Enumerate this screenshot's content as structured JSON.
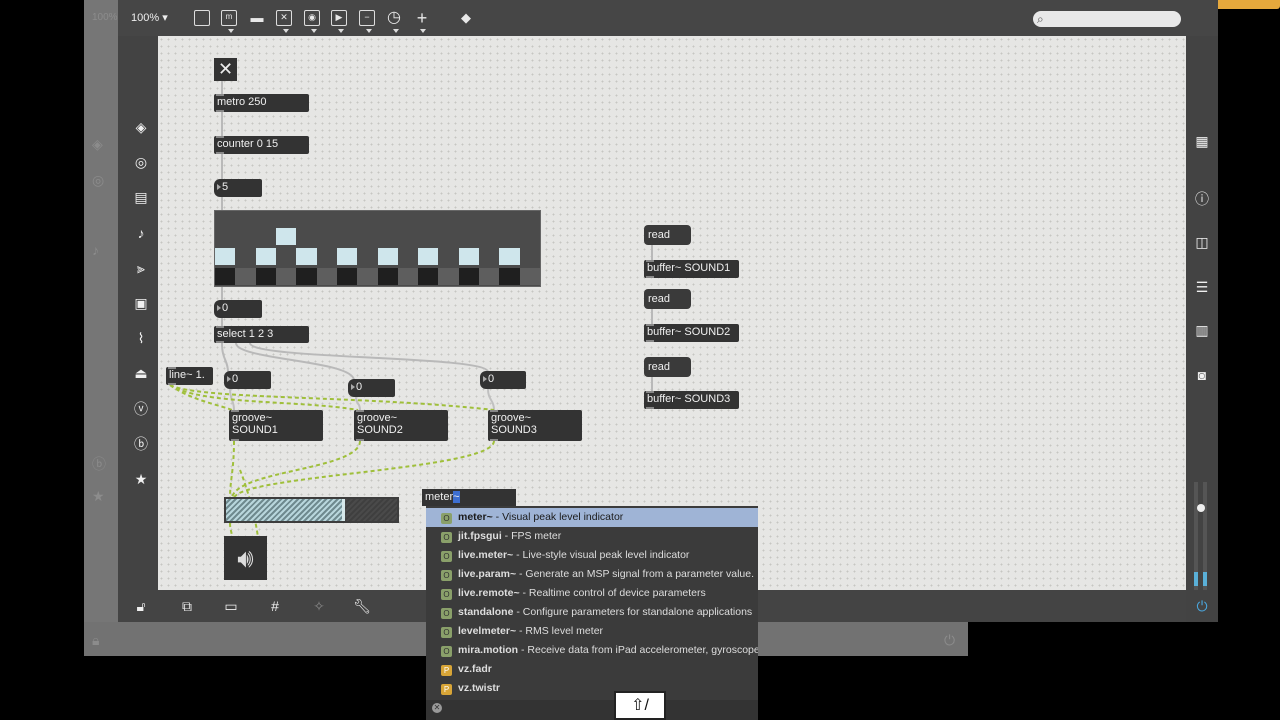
{
  "toolbar": {
    "zoom": "100% ▾",
    "icons": [
      "presentation-icon",
      "message-icon",
      "comment-icon",
      "toggle-icon",
      "button-icon",
      "play-icon",
      "slider-icon",
      "dial-icon",
      "plus-icon",
      "paint-icon"
    ]
  },
  "objects": {
    "metro": "metro 250",
    "counter": "counter 0 15",
    "num_counter": "5",
    "num_step": "0",
    "select": "select 1 2 3",
    "line": "line~ 1.",
    "num1": "0",
    "num2": "0",
    "num3": "0",
    "groove1": "groove~\nSOUND1",
    "groove2": "groove~\nSOUND2",
    "groove3": "groove~\nSOUND3",
    "read1": "read",
    "read2": "read",
    "read3": "read",
    "buffer1": "buffer~ SOUND1",
    "buffer2": "buffer~ SOUND2",
    "buffer3": "buffer~ SOUND3"
  },
  "meter": {
    "level": 0.68
  },
  "matrix": {
    "columns": 16,
    "rows": 3,
    "active_column_pattern": [
      1,
      0,
      1,
      0,
      1,
      0,
      1,
      0,
      1,
      0,
      1,
      0,
      1,
      0,
      1,
      0
    ],
    "highlight_col": 3,
    "colors": {
      "on": "#cfe6ec",
      "off": "#4b4b4b",
      "dark": "#1f1f1f",
      "mid": "#5e5e5e"
    }
  },
  "typing": {
    "prefix": "meter",
    "selected": "~"
  },
  "autocomplete": [
    {
      "type": "O",
      "name": "meter~",
      "desc": " - Visual peak level indicator",
      "selected": true
    },
    {
      "type": "O",
      "name": "jit.fpsgui",
      "desc": " - FPS meter"
    },
    {
      "type": "O",
      "name": "live.meter~",
      "desc": " - Live-style visual peak level indicator"
    },
    {
      "type": "O",
      "name": "live.param~",
      "desc": " - Generate an MSP signal from a parameter value."
    },
    {
      "type": "O",
      "name": "live.remote~",
      "desc": " - Realtime control of device parameters"
    },
    {
      "type": "O",
      "name": "standalone",
      "desc": " - Configure parameters for standalone applications"
    },
    {
      "type": "O",
      "name": "levelmeter~",
      "desc": " - RMS level meter"
    },
    {
      "type": "O",
      "name": "mira.motion",
      "desc": " - Receive data from iPad accelerometer, gyroscope ..."
    },
    {
      "type": "P",
      "name": "vz.fadr",
      "desc": ""
    },
    {
      "type": "P",
      "name": "vz.twistr",
      "desc": ""
    }
  ],
  "shift_key": "⇧/",
  "colors": {
    "accent": "#e6a83c",
    "canvas": "#e6e6e4",
    "object": "#333333",
    "selection": "#9fb4d6"
  }
}
